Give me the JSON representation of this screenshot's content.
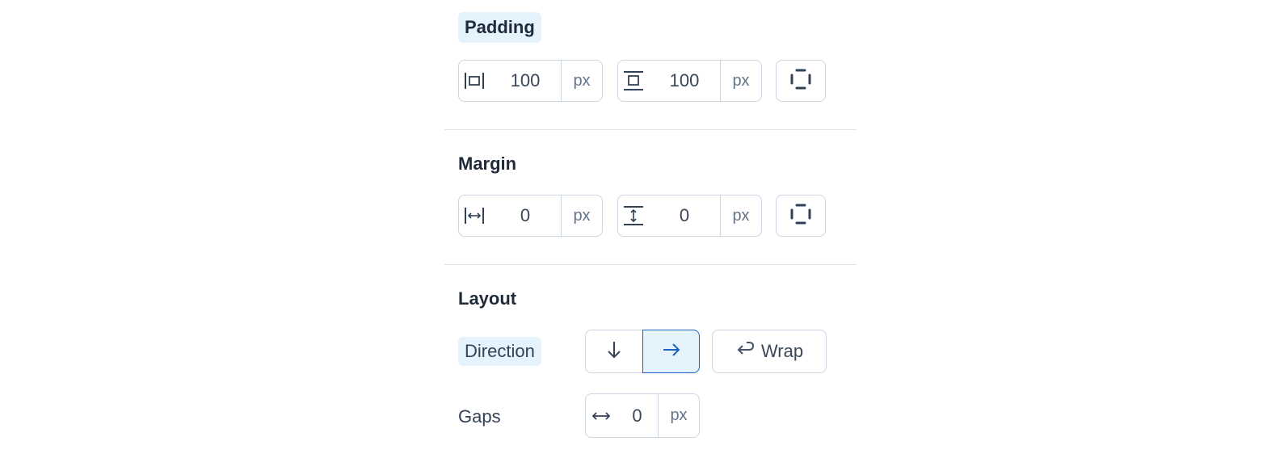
{
  "padding": {
    "title": "Padding",
    "horizontal": {
      "value": "100",
      "unit": "px",
      "icon": "padding-horizontal-icon"
    },
    "vertical": {
      "value": "100",
      "unit": "px",
      "icon": "padding-vertical-icon"
    },
    "individual_sides_icon": "individual-sides-icon"
  },
  "margin": {
    "title": "Margin",
    "horizontal": {
      "value": "0",
      "unit": "px",
      "icon": "margin-horizontal-icon"
    },
    "vertical": {
      "value": "0",
      "unit": "px",
      "icon": "margin-vertical-icon"
    },
    "individual_sides_icon": "individual-sides-icon"
  },
  "layout": {
    "title": "Layout",
    "direction_label": "Direction",
    "direction_options": [
      {
        "icon": "arrow-down-icon",
        "selected": false
      },
      {
        "icon": "arrow-right-icon",
        "selected": true
      }
    ],
    "wrap_label": "Wrap",
    "gaps_label": "Gaps",
    "gap": {
      "value": "0",
      "unit": "px",
      "icon": "horizontal-gap-icon"
    }
  },
  "colors": {
    "accent": "#1e63c4",
    "highlight": "#e5f3fd",
    "border": "#cbd5e1"
  }
}
